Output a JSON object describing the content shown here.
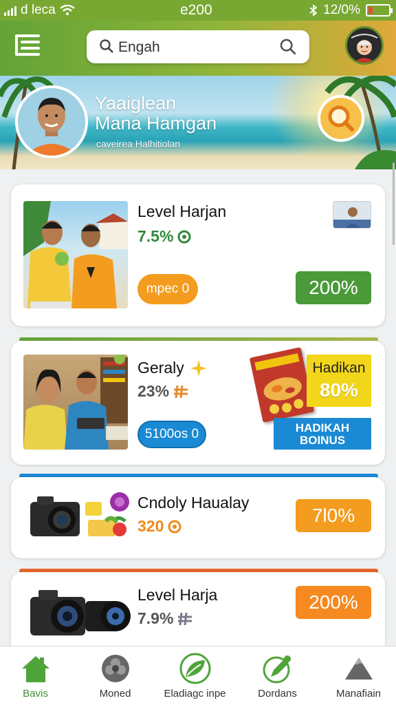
{
  "status_bar": {
    "carrier": "d leca",
    "time": "e200",
    "battery": "12/0%"
  },
  "header": {
    "search_text": "Engah",
    "menu_icon": "menu-icon",
    "avatar_icon": "profile-avatar"
  },
  "hero": {
    "title_line1": "Yaaiglean",
    "title_line2": "Mana Hamgan",
    "subtitle": "caveirea Halhitiolan",
    "search_icon": "search-icon"
  },
  "cards": [
    {
      "title": "Level Harjan",
      "percent": "7.5%",
      "tag": "mpec 0",
      "action": "200%",
      "colors": {
        "pct": "#2f8a3a",
        "tag": "#f39c1f",
        "action": "#4a9a3a"
      }
    },
    {
      "title": "Geraly",
      "percent": "23%",
      "tag": "5100os 0",
      "promo_title": "Hadikan",
      "promo_value": "80%",
      "bonus": "HADIKAH BOINUS",
      "colors": {
        "pct": "#555555",
        "tag": "#1a8ad4",
        "promo": "#f2d61a",
        "bonus": "#1a8ad4"
      }
    },
    {
      "title": "Cndoly Haualay",
      "percent": "320",
      "action": "7l0%",
      "colors": {
        "pct": "#f08a16",
        "action": "#f39c1f"
      }
    },
    {
      "title": "Level Harja",
      "percent": "7.9%",
      "action": "200%",
      "colors": {
        "pct": "#555555",
        "action": "#f6891f"
      }
    }
  ],
  "nav": [
    {
      "label": "Bavis",
      "icon": "home-icon",
      "active": true
    },
    {
      "label": "Moned",
      "icon": "flower-icon"
    },
    {
      "label": "Eladiagc inpe",
      "icon": "leaf-icon"
    },
    {
      "label": "Dordans",
      "icon": "edit-icon"
    },
    {
      "label": "Manafiain",
      "icon": "mountain-icon"
    }
  ]
}
